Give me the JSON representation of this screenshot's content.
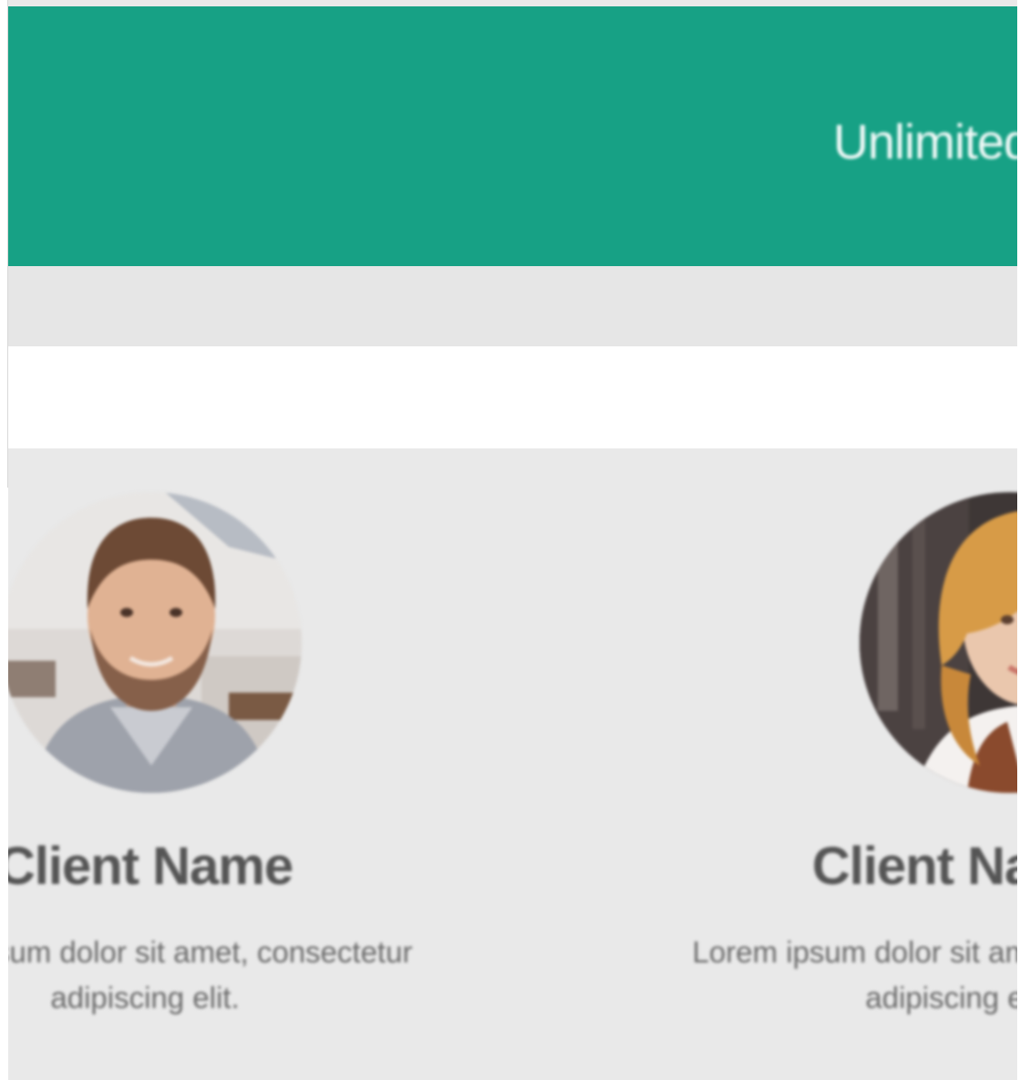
{
  "hero": {
    "tagline": "Unlimited",
    "background_color": "#17a185",
    "text_color": "#ffffff"
  },
  "testimonials": {
    "background_color": "#e9e9e9",
    "clients": [
      {
        "name": "Client Name",
        "quote": "Lorem ipsum dolor sit amet, consectetur adipiscing elit.",
        "avatar_icon": "man-portrait"
      },
      {
        "name": "Client Name",
        "quote": "Lorem ipsum dolor sit amet, consectetur adipiscing elit.",
        "avatar_icon": "woman-portrait"
      }
    ]
  }
}
